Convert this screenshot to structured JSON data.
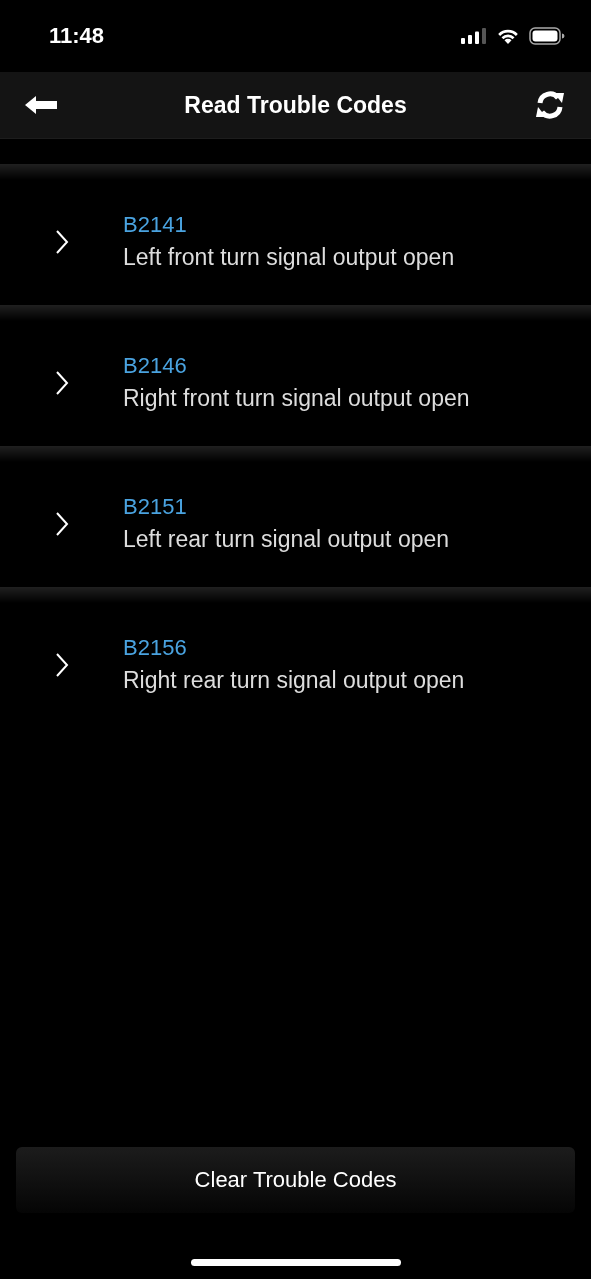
{
  "status_bar": {
    "time": "11:48"
  },
  "header": {
    "title": "Read Trouble Codes"
  },
  "codes": [
    {
      "code": "B2141",
      "description": "Left front turn signal output open"
    },
    {
      "code": "B2146",
      "description": "Right front turn signal output open"
    },
    {
      "code": "B2151",
      "description": "Left rear turn signal output open"
    },
    {
      "code": "B2156",
      "description": "Right rear turn signal output open"
    }
  ],
  "clear_button": {
    "label": "Clear Trouble Codes"
  }
}
